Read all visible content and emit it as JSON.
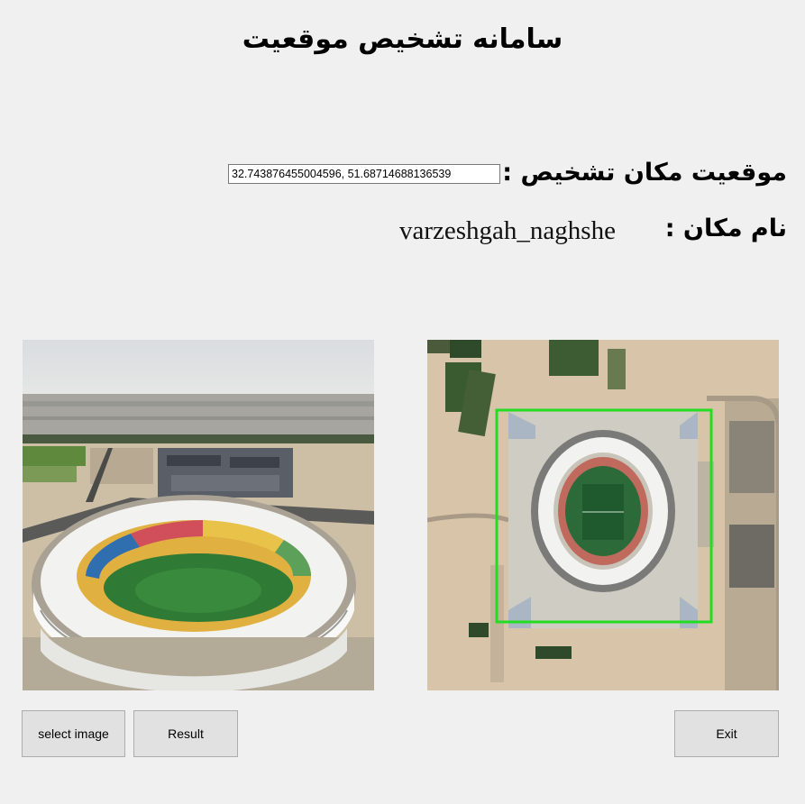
{
  "window": {
    "title": "سامانه تشخیص موقعیت"
  },
  "location": {
    "coord_label": "موقعیت مکان تشخیص :",
    "coord_value": "32.743876455004596, 51.68714688136539",
    "name_label": "نام مکان :",
    "name_value": "varzeshgah_naghshe"
  },
  "images": {
    "query_photo": "stadium-aerial-photo",
    "satellite_map": "satellite-map-with-detection-box"
  },
  "colors": {
    "detection_box": "#22dd22",
    "background": "#f0f0f0"
  },
  "buttons": {
    "select_label": "select image",
    "result_label": "Result",
    "exit_label": "Exit"
  }
}
